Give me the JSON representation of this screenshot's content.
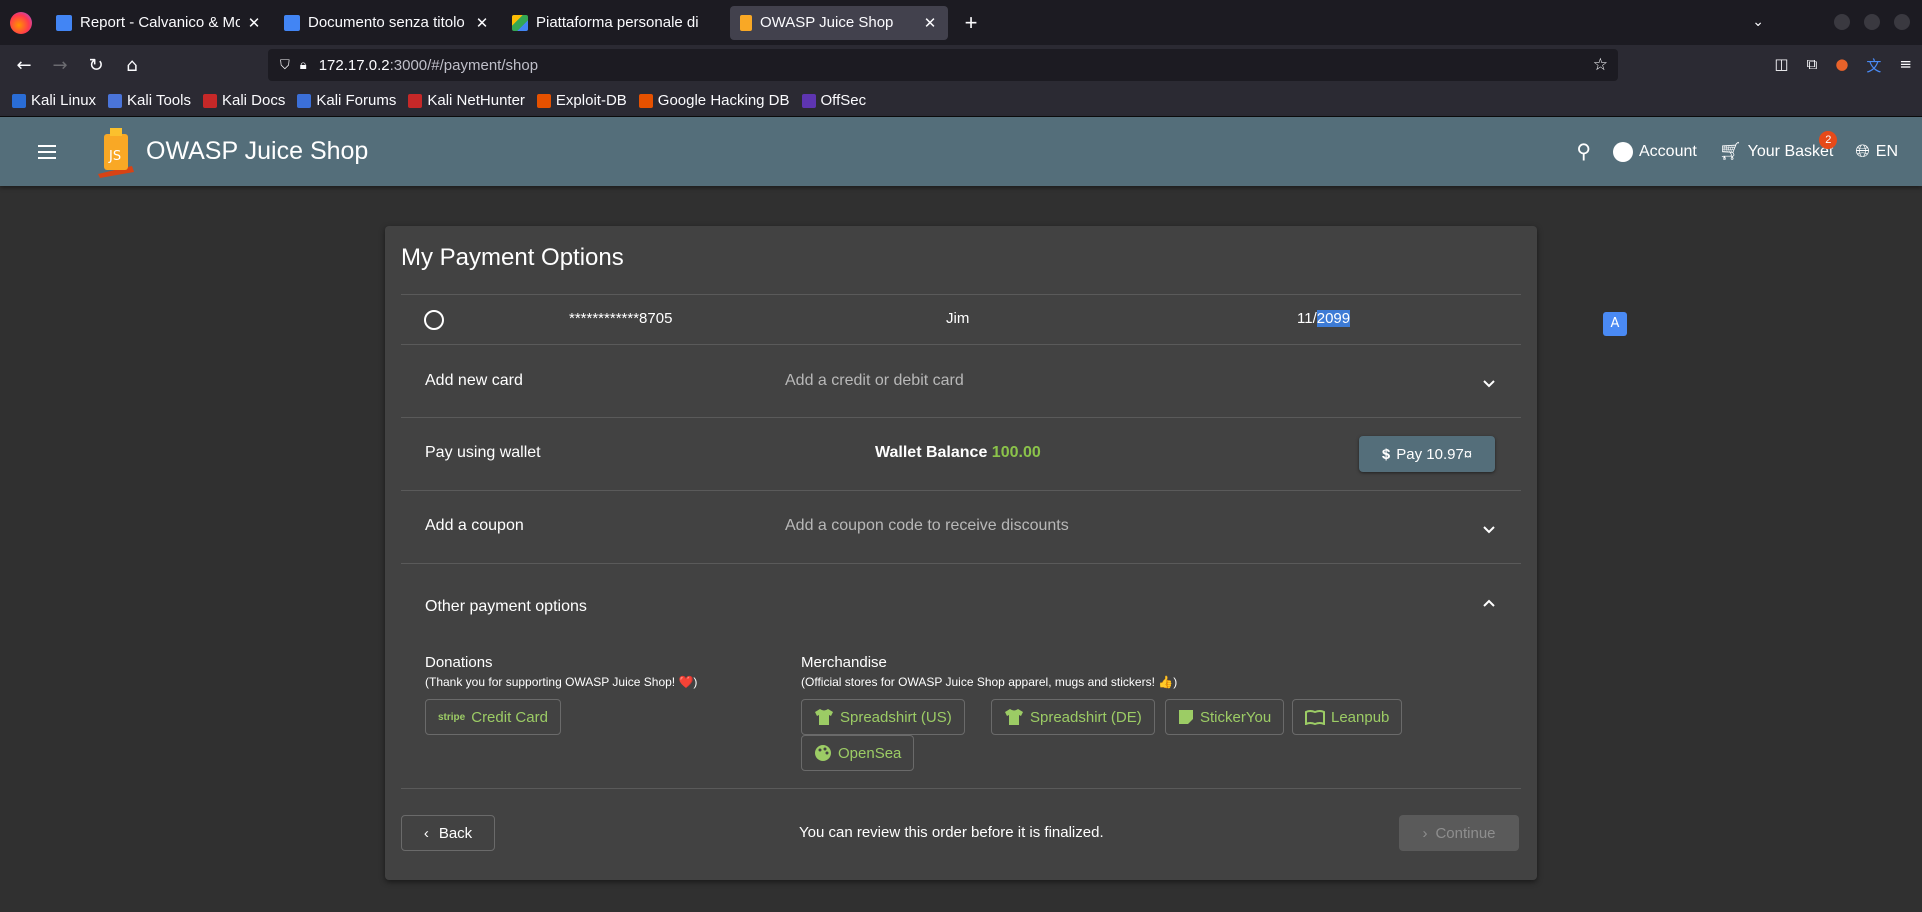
{
  "browser": {
    "tabs": [
      {
        "title": "Report - Calvanico & Mon",
        "icon_color": "#4285f4"
      },
      {
        "title": "Documento senza titolo -",
        "icon_color": "#4285f4"
      },
      {
        "title": "Piattaforma personale di",
        "icon_color": "#34a853"
      },
      {
        "title": "OWASP Juice Shop",
        "icon_color": "#f9a825"
      }
    ],
    "url_host": "172.17.0.2",
    "url_path": ":3000/#/payment/shop",
    "bookmarks": [
      "Kali Linux",
      "Kali Tools",
      "Kali Docs",
      "Kali Forums",
      "Kali NetHunter",
      "Exploit-DB",
      "Google Hacking DB",
      "OffSec"
    ]
  },
  "app": {
    "title": "OWASP Juice Shop",
    "account_label": "Account",
    "basket_label": "Your Basket",
    "basket_count": "2",
    "language": "EN",
    "accent": "#546e7a"
  },
  "payment": {
    "heading": "My Payment Options",
    "card": {
      "number": "************8705",
      "holder": "Jim",
      "expiry_month": "11/",
      "expiry_year": "2099"
    },
    "add_card": {
      "label": "Add new card",
      "hint": "Add a credit or debit card"
    },
    "wallet": {
      "label": "Pay using wallet",
      "balance_label": "Wallet Balance",
      "balance_value": "100.00",
      "pay_label": "Pay 10.97¤"
    },
    "coupon": {
      "label": "Add a coupon",
      "hint": "Add a coupon code to receive discounts"
    },
    "other": {
      "label": "Other payment options",
      "donations_title": "Donations",
      "donations_note": "(Thank you for supporting OWASP Juice Shop! ❤️)",
      "credit_card_label": "Credit Card",
      "stripe_text": "stripe",
      "merch_title": "Merchandise",
      "merch_note": "(Official stores for OWASP Juice Shop apparel, mugs and stickers! 👍)",
      "stores": [
        "Spreadshirt (US)",
        "Spreadshirt (DE)",
        "StickerYou",
        "Leanpub",
        "OpenSea"
      ]
    },
    "review_note": "You can review this order before it is finalized.",
    "back_label": "Back",
    "continue_label": "Continue"
  }
}
